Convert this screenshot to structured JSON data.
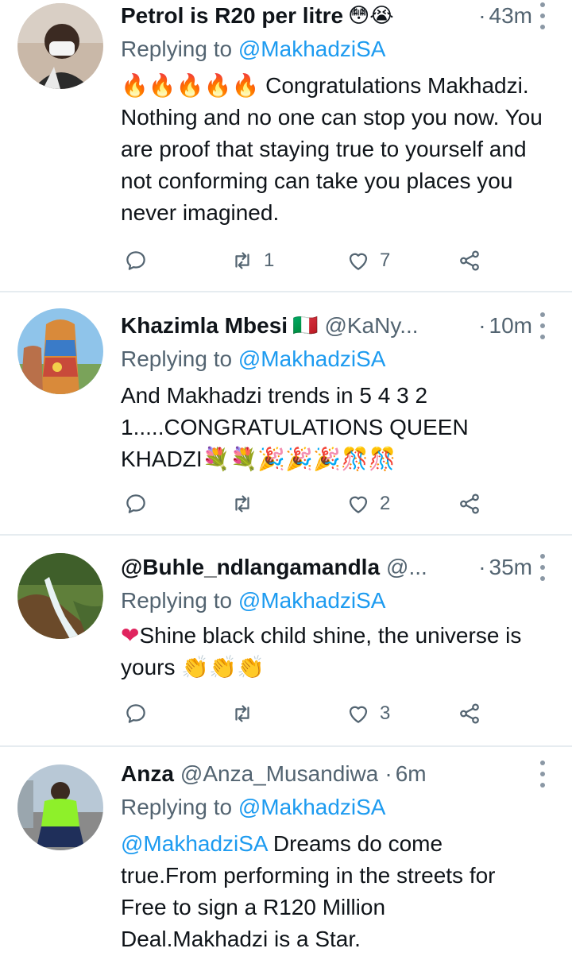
{
  "tweets": [
    {
      "name": "Petrol is R20 per litre",
      "name_emoji": "😳😭",
      "handle": "",
      "dot": "·",
      "time": "43m",
      "reply_prefix": "Replying to",
      "reply_to": "@MakhadziSA",
      "body_mention": "",
      "body_emoji_prefix": "🔥🔥🔥🔥🔥",
      "body": " Congratulations Makhadzi. Nothing and no one can stop you now. You are proof that staying true to yourself and not conforming can take you places you never imagined.",
      "body_emoji_suffix": "",
      "retweets": "1",
      "likes": "7"
    },
    {
      "name": "Khazimla Mbesi",
      "name_emoji": "🇮🇹",
      "handle": "@KaNy...",
      "dot": "·",
      "time": "10m",
      "reply_prefix": "Replying to",
      "reply_to": "@MakhadziSA",
      "body_mention": "",
      "body_emoji_prefix": "",
      "body": "And Makhadzi trends in 5 4 3 2 1.....CONGRATULATIONS QUEEN KHADZI",
      "body_emoji_suffix": "💐💐🎉🎉🎉🎊🎊",
      "retweets": "",
      "likes": "2"
    },
    {
      "name": "@Buhle_ndlangamandla",
      "name_emoji": "",
      "handle": "@...",
      "dot": "·",
      "time": "35m",
      "reply_prefix": "Replying to",
      "reply_to": "@MakhadziSA",
      "body_mention": "",
      "body_emoji_prefix": "❤",
      "body": "Shine black child shine, the universe is yours ",
      "body_emoji_suffix": "👏👏👏",
      "retweets": "",
      "likes": "3"
    },
    {
      "name": "Anza",
      "name_emoji": "",
      "handle": "@Anza_Musandiwa",
      "dot": "·",
      "time": "6m",
      "reply_prefix": "Replying to",
      "reply_to": "@MakhadziSA",
      "body_mention": "@MakhadziSA",
      "body_emoji_prefix": "",
      "body": "  Dreams do come true.From performing in the streets for Free to sign a R120 Million Deal.Makhadzi is a Star.",
      "body_emoji_suffix": "",
      "retweets": "",
      "likes": ""
    }
  ],
  "icons": {
    "reply": "reply-icon",
    "retweet": "retweet-icon",
    "like": "heart-icon",
    "share": "share-icon",
    "more": "more-vertical-icon"
  },
  "colors": {
    "text": "#0f1419",
    "muted": "#536471",
    "accent": "#1d9bf0",
    "divider": "#e6ecf0"
  }
}
